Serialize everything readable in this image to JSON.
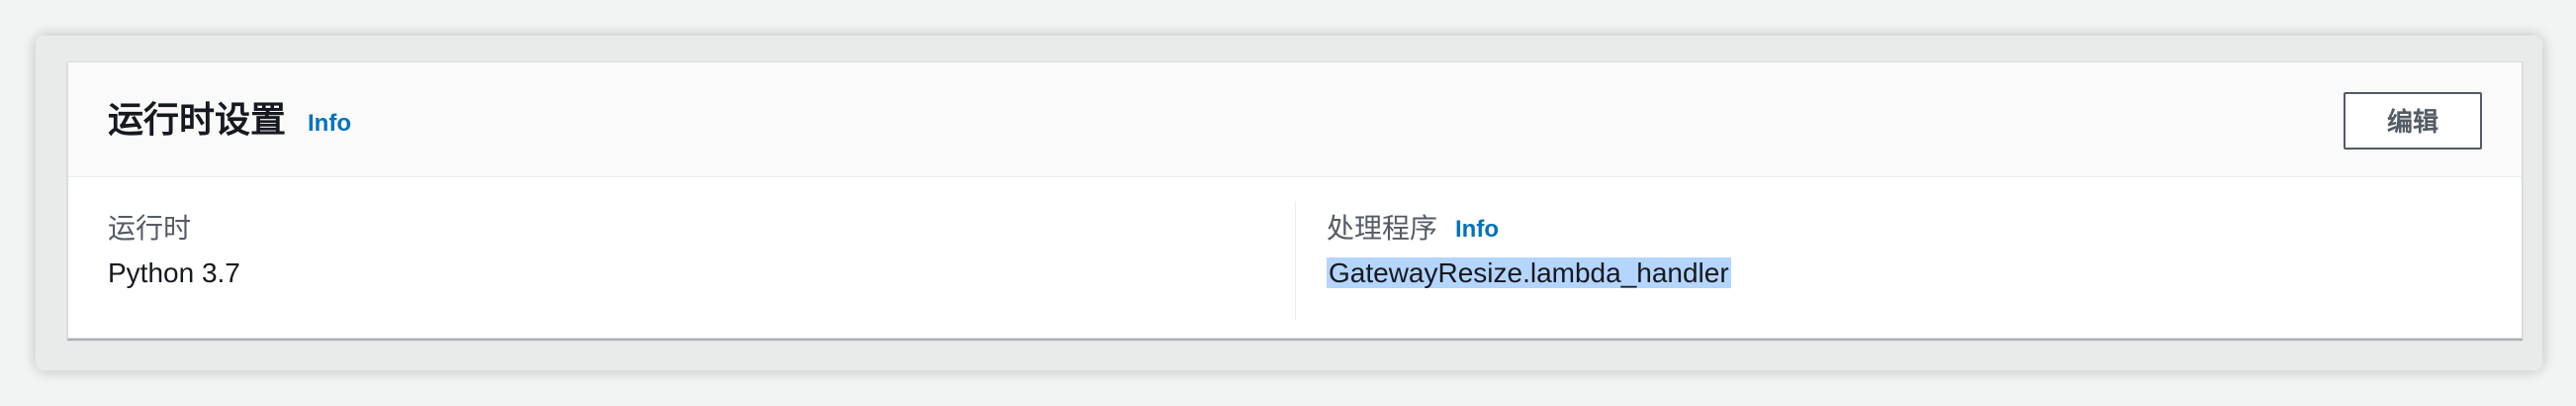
{
  "runtime_settings": {
    "title": "运行时设置",
    "info_label": "Info",
    "edit_label": "编辑",
    "runtime": {
      "label": "运行时",
      "value": "Python 3.7"
    },
    "handler": {
      "label": "处理程序",
      "info_label": "Info",
      "value": "GatewayResize.lambda_handler"
    }
  },
  "colors": {
    "link": "#0073bb",
    "selection": "#b4d5fe",
    "text": "#16191f"
  }
}
